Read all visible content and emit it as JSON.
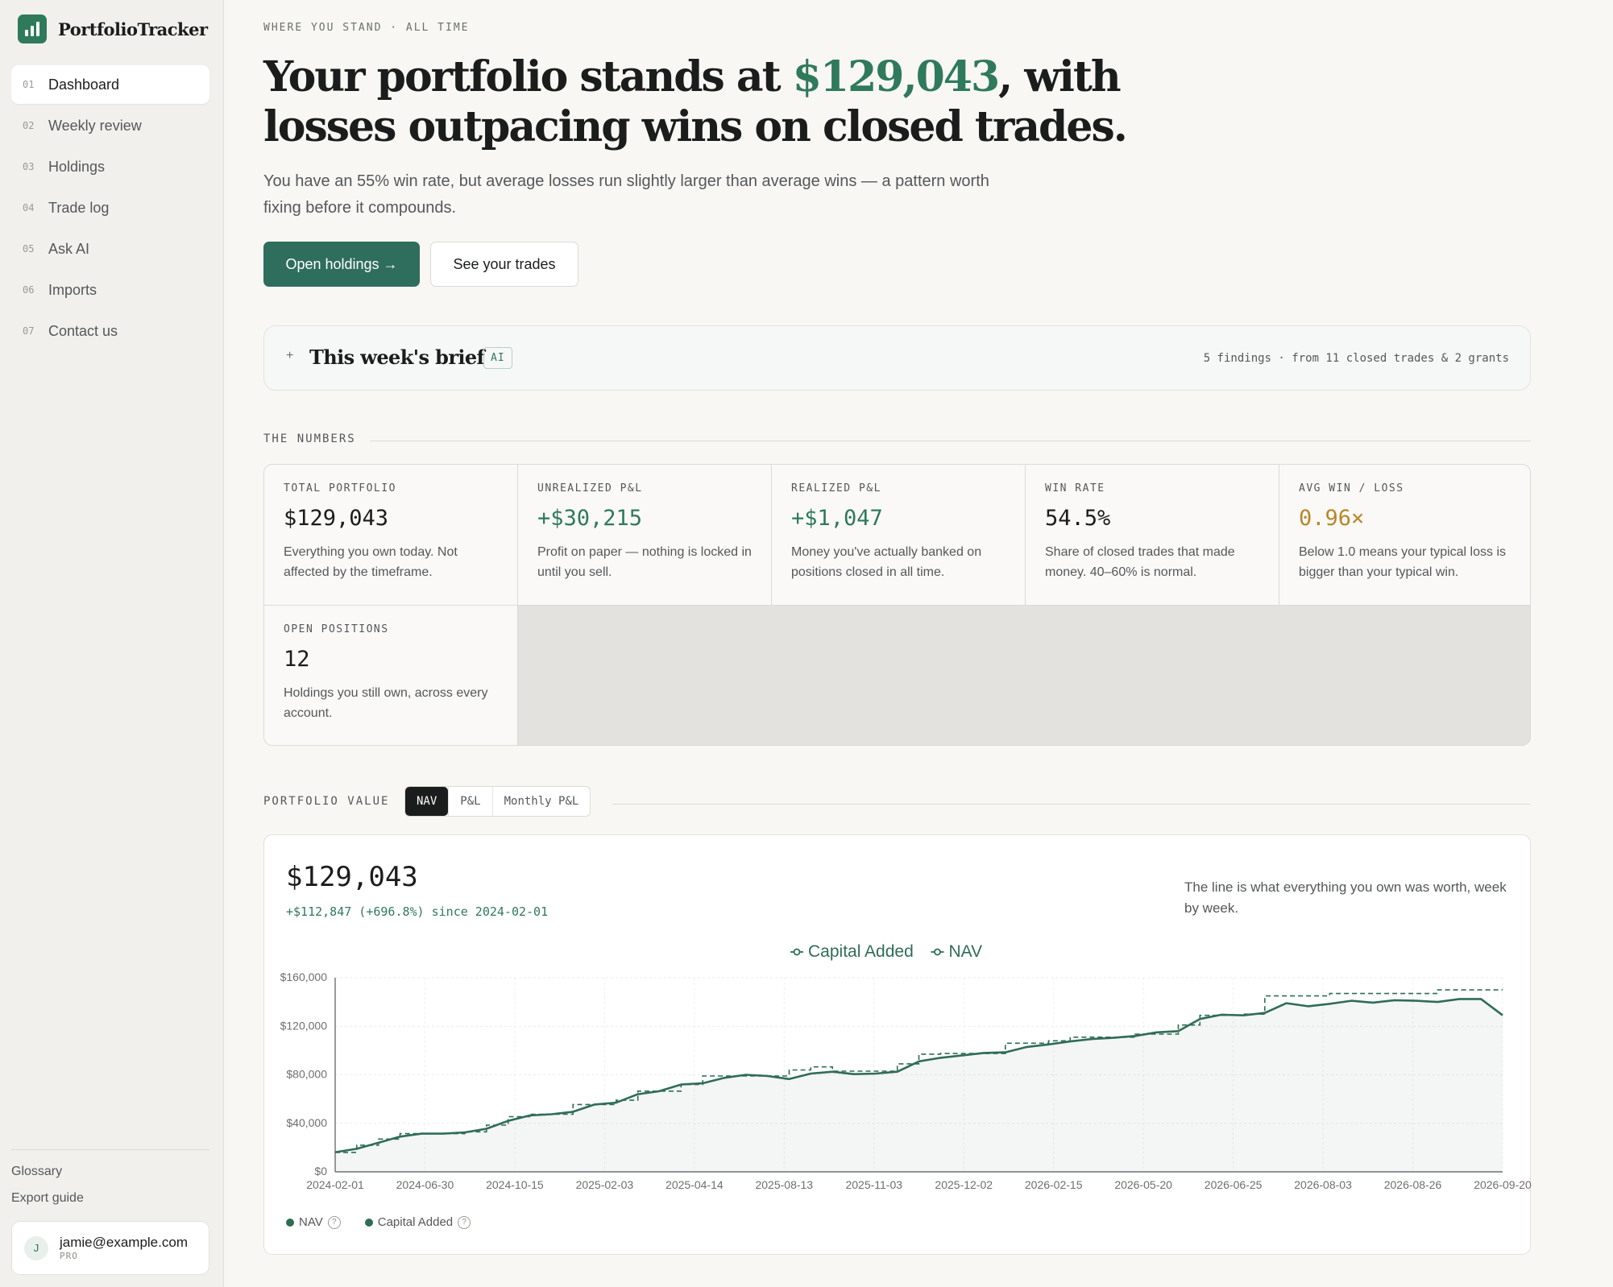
{
  "app": {
    "name": "PortfolioTracker"
  },
  "sidebar": {
    "items": [
      {
        "num": "01",
        "label": "Dashboard",
        "active": true
      },
      {
        "num": "02",
        "label": "Weekly review"
      },
      {
        "num": "03",
        "label": "Holdings"
      },
      {
        "num": "04",
        "label": "Trade log"
      },
      {
        "num": "05",
        "label": "Ask AI"
      },
      {
        "num": "06",
        "label": "Imports"
      },
      {
        "num": "07",
        "label": "Contact us"
      }
    ],
    "glossary": "Glossary",
    "export_guide": "Export guide",
    "user": {
      "initial": "J",
      "email": "jamie@example.com",
      "plan": "PRO"
    }
  },
  "hero": {
    "eyebrow": "WHERE YOU STAND · ALL TIME",
    "headline_pre": "Your portfolio stands at ",
    "headline_value": "$129,043",
    "headline_post": ", with losses outpacing wins on closed trades.",
    "lede": "You have an 55% win rate, but average losses run slightly larger than average wins — a pattern worth fixing before it compounds.",
    "primary_button": "Open holdings →",
    "secondary_button": "See your trades"
  },
  "brief": {
    "plus": "+",
    "title": "This week's brief",
    "badge": "AI",
    "meta": "5 findings · from 11 closed trades & 2 grants"
  },
  "numbers": {
    "section_label": "THE NUMBERS",
    "stats": [
      {
        "label": "TOTAL PORTFOLIO",
        "value": "$129,043",
        "tone": "neutral",
        "desc": "Everything you own today. Not affected by the timeframe."
      },
      {
        "label": "UNREALIZED P&L",
        "value": "+$30,215",
        "tone": "pos",
        "desc": "Profit on paper — nothing is locked in until you sell."
      },
      {
        "label": "REALIZED P&L",
        "value": "+$1,047",
        "tone": "pos",
        "desc": "Money you've actually banked on positions closed in all time."
      },
      {
        "label": "WIN RATE",
        "value": "54.5%",
        "tone": "neutral",
        "desc": "Share of closed trades that made money. 40–60% is normal."
      },
      {
        "label": "AVG WIN / LOSS",
        "value": "0.96×",
        "tone": "warn",
        "desc": "Below 1.0 means your typical loss is bigger than your typical win."
      },
      {
        "label": "OPEN POSITIONS",
        "value": "12",
        "tone": "neutral",
        "desc": "Holdings you still own, across every account."
      }
    ]
  },
  "portfolio_value": {
    "section_label": "PORTFOLIO VALUE",
    "tabs": [
      {
        "label": "NAV",
        "active": true
      },
      {
        "label": "P&L"
      },
      {
        "label": "Monthly P&L"
      }
    ],
    "big_value": "$129,043",
    "delta": "+$112,847 (+696.8%) since 2024-02-01",
    "note": "The line is what everything you own was worth, week by week.",
    "footer_legend": [
      "NAV",
      "Capital Added"
    ],
    "help_glyph": "?"
  },
  "colors": {
    "accent": "#2f7a5b",
    "primary_button": "#2f6d5c",
    "warn": "#b8862a",
    "line": "#2f6d55"
  },
  "chart_data": {
    "type": "line",
    "legend": [
      "Capital Added",
      "NAV"
    ],
    "legend_placement": "top-center",
    "ylim": [
      0,
      160000
    ],
    "yticks": [
      "$0",
      "$40,000",
      "$80,000",
      "$120,000",
      "$160,000"
    ],
    "xticks": [
      "2024-02-01",
      "2024-06-30",
      "2024-10-15",
      "2025-02-03",
      "2025-04-14",
      "2025-08-13",
      "2025-11-03",
      "2025-12-02",
      "2026-02-15",
      "2026-05-20",
      "2026-06-25",
      "2026-08-03",
      "2026-08-26",
      "2026-09-20"
    ],
    "grid": true,
    "series": [
      {
        "name": "NAV",
        "style": "solid",
        "values": [
          16196,
          19000,
          24000,
          29000,
          31500,
          31500,
          32500,
          35500,
          42000,
          46500,
          47500,
          49500,
          55500,
          57000,
          64000,
          66500,
          72000,
          73000,
          77500,
          80000,
          79000,
          76500,
          81000,
          82500,
          80500,
          81000,
          82500,
          91000,
          94000,
          96000,
          98000,
          98500,
          103000,
          105000,
          107500,
          109500,
          110500,
          112000,
          115000,
          116000,
          126000,
          129500,
          129000,
          131000,
          139000,
          136500,
          138500,
          141000,
          139500,
          141500,
          141000,
          140000,
          142500,
          142500,
          129043
        ]
      },
      {
        "name": "Capital Added",
        "style": "dashed",
        "values": [
          16000,
          16000,
          22000,
          27000,
          31500,
          31500,
          31500,
          33000,
          38500,
          45500,
          47500,
          47500,
          55500,
          55500,
          59000,
          66500,
          66500,
          72000,
          79000,
          79000,
          79000,
          79000,
          84000,
          86500,
          83000,
          83000,
          83000,
          89000,
          97000,
          97500,
          97500,
          97500,
          106000,
          106000,
          108000,
          111000,
          111000,
          111000,
          113500,
          113500,
          121000,
          129000,
          129000,
          130000,
          145000,
          145000,
          145000,
          147000,
          147000,
          147000,
          147000,
          147000,
          150000,
          150000,
          150000
        ]
      }
    ]
  }
}
